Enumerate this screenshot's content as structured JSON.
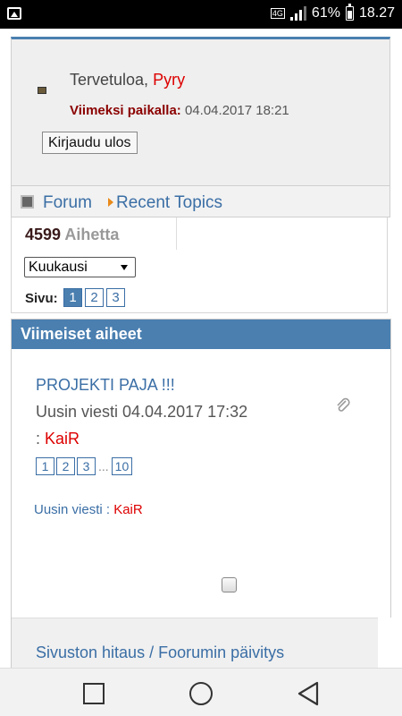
{
  "status_bar": {
    "network": "4G",
    "battery": "61%",
    "battery_level": 0.61,
    "time": "18.27"
  },
  "welcome": {
    "greeting": "Tervetuloa,",
    "username": "Pyry",
    "last_visit_label": "Viimeksi paikalla:",
    "last_visit_value": "04.04.2017 18:21",
    "logout_label": "Kirjaudu ulos"
  },
  "breadcrumb": {
    "forum": "Forum",
    "recent_topics": "Recent Topics"
  },
  "stats": {
    "topic_count": "4599",
    "topic_unit": "Aihetta",
    "period_selected": "Kuukausi",
    "page_label": "Sivu:",
    "pages": [
      "1",
      "2",
      "3"
    ],
    "active_page": "1"
  },
  "latest": {
    "header": "Viimeiset aiheet",
    "topic": {
      "title": "PROJEKTI PAJA !!!",
      "last_post_text": "Uusin viesti 04.04.2017 17:32",
      "by_prefix": ":",
      "author": "KaiR",
      "pages": [
        "1",
        "2",
        "3"
      ],
      "ellipsis": "...",
      "last_page": "10"
    },
    "last_post_label": "Uusin viesti :",
    "last_post_author": "KaiR",
    "next_topic_title": "Sivuston hitaus / Foorumin päivitys"
  },
  "icons": {
    "gallery": "gallery-icon",
    "signal": "signal-icon",
    "battery": "battery-icon",
    "attachment": "paperclip-icon",
    "recent_square": "square-icon",
    "arrow": "triangle-right-icon",
    "nav_recents": "square-outline-icon",
    "nav_home": "circle-outline-icon",
    "nav_back": "triangle-left-outline-icon"
  },
  "colors": {
    "accent": "#4a7fb0",
    "link": "#3a6ea5",
    "username": "#dd0000",
    "arrow": "#e88a1a"
  }
}
